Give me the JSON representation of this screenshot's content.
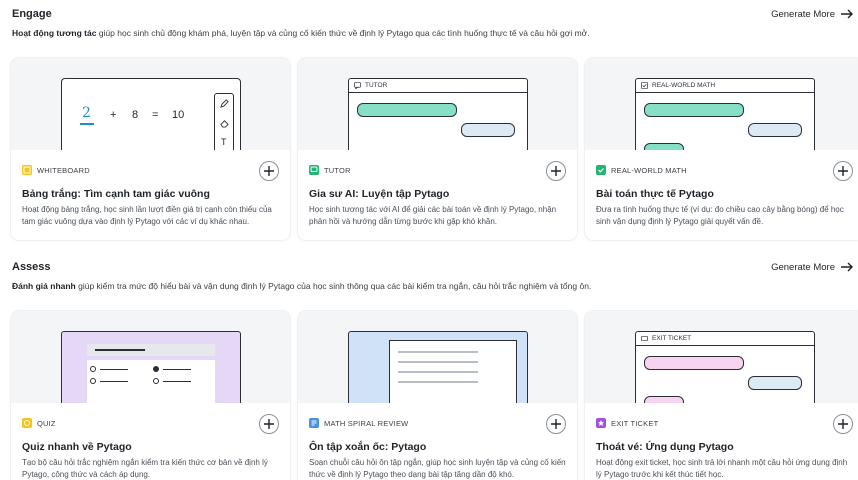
{
  "sections": [
    {
      "title": "Engage",
      "generate_more": "Generate More",
      "desc_bold": "Hoạt động tương tác",
      "desc_rest": " giúp học sinh chủ động khám phá, luyện tập và củng cố kiến thức về định lý Pytago qua các tình huống thực tế và câu hỏi gợi mở.",
      "cards": [
        {
          "tag": "WHITEBOARD",
          "title": "Bảng trắng: Tìm cạnh tam giác vuông",
          "desc": "Hoạt động bảng trắng, học sinh lần lượt điền giá trị cạnh còn thiếu của tam giác vuông dựa vào định lý Pytago với các ví dụ khác nhau.",
          "preview": {
            "n1": "2",
            "plus": "+",
            "n2": "8",
            "eq": "=",
            "n3": "10",
            "tool_t": "T"
          }
        },
        {
          "tag": "TUTOR",
          "title": "Gia sư AI: Luyện tập Pytago",
          "desc": "Học sinh tương tác với AI để giải các bài toán về định lý Pytago, nhận phản hồi và hướng dẫn từng bước khi gặp khó khăn.",
          "preview": {
            "bar": "TUTOR"
          }
        },
        {
          "tag": "REAL-WORLD MATH",
          "title": "Bài toán thực tế Pytago",
          "desc": "Đưa ra tình huống thực tế (ví dụ: đo chiều cao cây bằng bóng) để học sinh vận dụng định lý Pytago giải quyết vấn đề.",
          "preview": {
            "bar": "REAL-WORLD MATH"
          }
        }
      ]
    },
    {
      "title": "Assess",
      "generate_more": "Generate More",
      "desc_bold": "Đánh giá nhanh",
      "desc_rest": " giúp kiểm tra mức độ hiểu bài và vận dụng định lý Pytago của học sinh thông qua các bài kiểm tra ngắn, câu hỏi trắc nghiệm và tổng ôn.",
      "cards": [
        {
          "tag": "QUIZ",
          "title": "Quiz nhanh về Pytago",
          "desc": "Tạo bộ câu hỏi trắc nghiệm ngắn kiểm tra kiến thức cơ bản về định lý Pytago, công thức và cách áp dụng."
        },
        {
          "tag": "MATH SPIRAL REVIEW",
          "title": "Ôn tập xoắn ốc: Pytago",
          "desc": "Soạn chuỗi câu hỏi ôn tập ngắn, giúp học sinh luyện tập và củng cố kiến thức về định lý Pytago theo dạng bài tập tăng dần độ khó."
        },
        {
          "tag": "EXIT TICKET",
          "title": "Thoát vé: Ứng dụng Pytago",
          "desc": "Hoạt động exit ticket, học sinh trả lời nhanh một câu hỏi ứng dụng định lý Pytago trước khi kết thúc tiết học.",
          "preview": {
            "bar": "EXIT TICKET"
          }
        }
      ]
    }
  ],
  "colors": {
    "whiteboard": "#f5c518",
    "tutor": "#22b573",
    "realworld": "#22b573",
    "quiz": "#b57be8",
    "spiral": "#4a8fe0",
    "exit": "#a34fe0",
    "bubble_green": "#86e0c8",
    "bubble_blue": "#dceaf4"
  }
}
